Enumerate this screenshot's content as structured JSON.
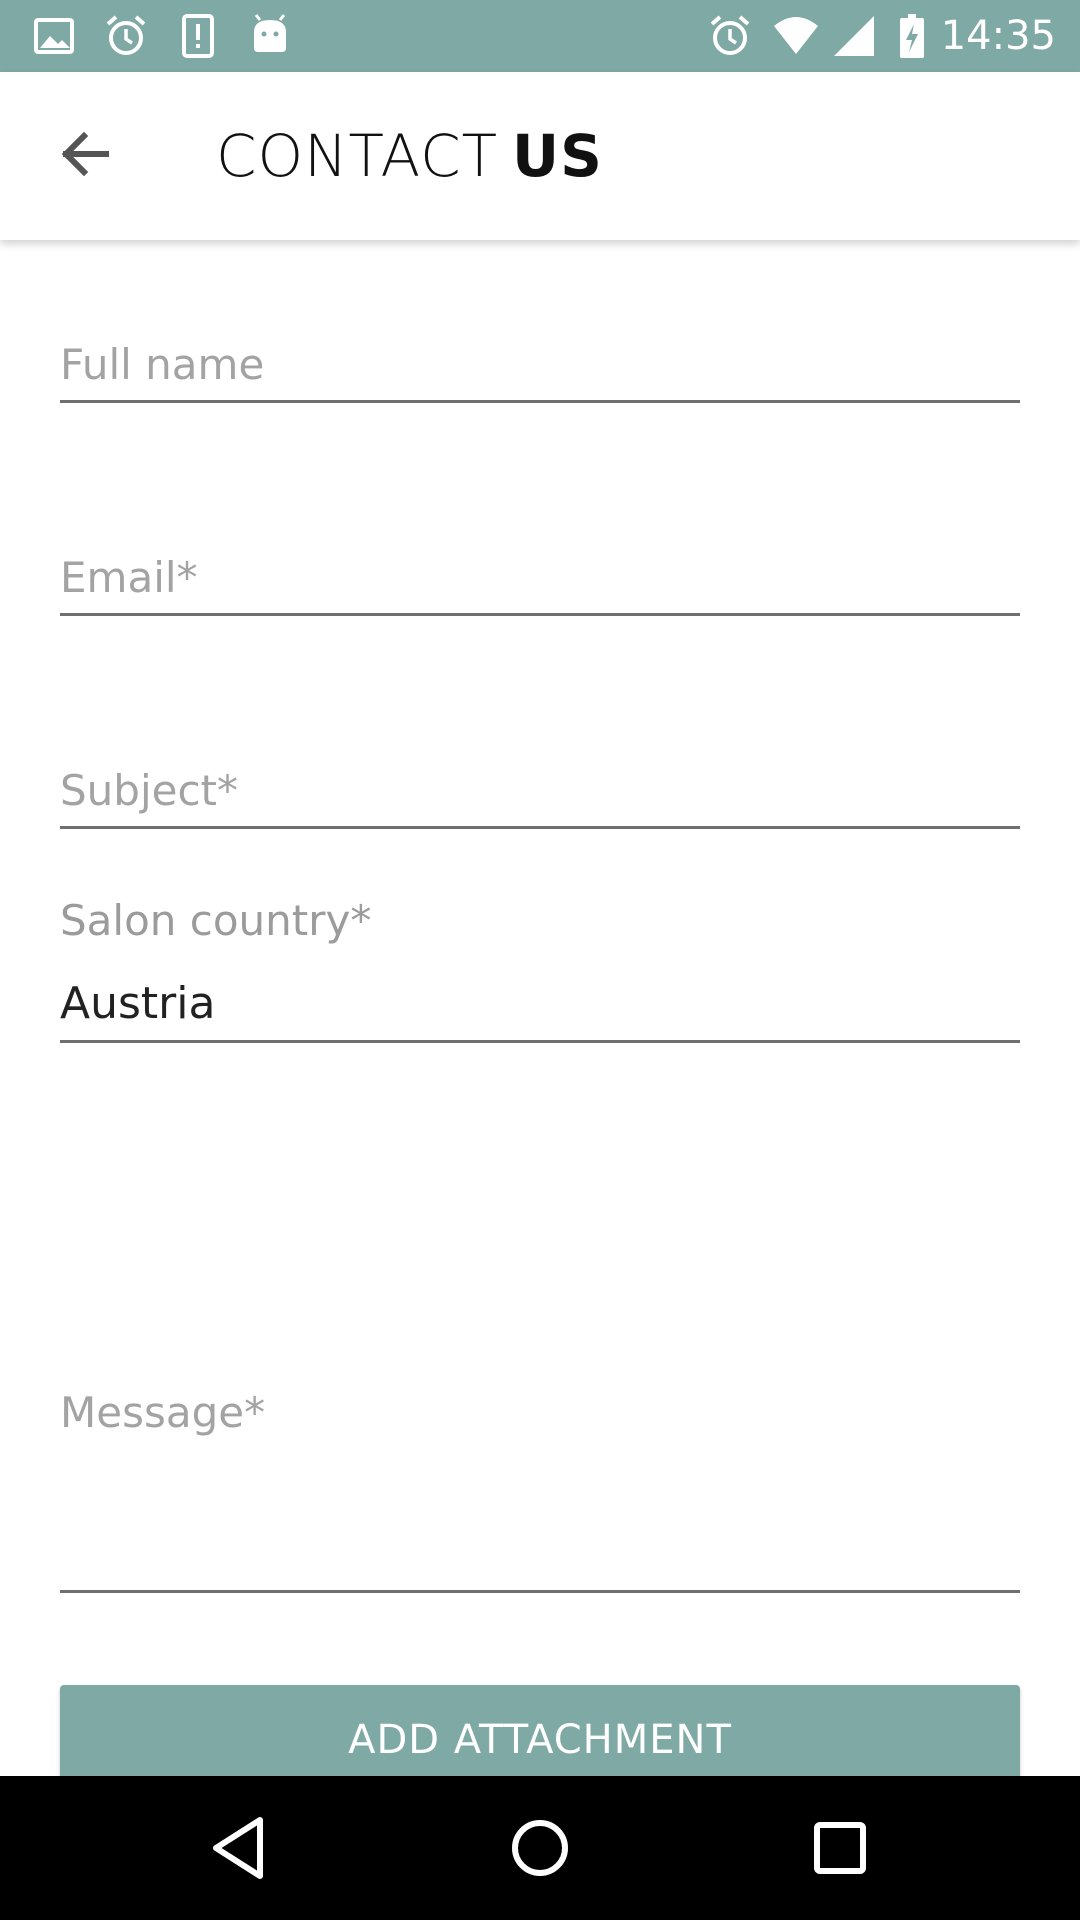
{
  "status_bar": {
    "background": "#7fa9a4",
    "left_icons": [
      "image-icon",
      "alarm-icon",
      "alert-icon",
      "android-icon"
    ],
    "right_icons": [
      "alarm-icon",
      "wifi-icon",
      "signal-icon",
      "battery-charging-icon"
    ],
    "time": "14:35"
  },
  "app_bar": {
    "back_icon": "arrow-back-icon",
    "title_light": "CONTACT",
    "title_bold": "US"
  },
  "form": {
    "full_name": {
      "placeholder": "Full name",
      "value": ""
    },
    "email": {
      "placeholder": "Email*",
      "value": ""
    },
    "subject": {
      "placeholder": "Subject*",
      "value": ""
    },
    "salon_country": {
      "label": "Salon country*",
      "value": "Austria"
    },
    "message": {
      "placeholder": "Message*",
      "value": ""
    },
    "attach_button_label": "ADD ATTACHMENT"
  },
  "nav_bar": {
    "icons": [
      "back-triangle-icon",
      "home-circle-icon",
      "recents-square-icon"
    ]
  },
  "colors": {
    "accent": "#7fa9a4",
    "underline": "#6f6f6f",
    "placeholder": "#a3a3a3"
  }
}
